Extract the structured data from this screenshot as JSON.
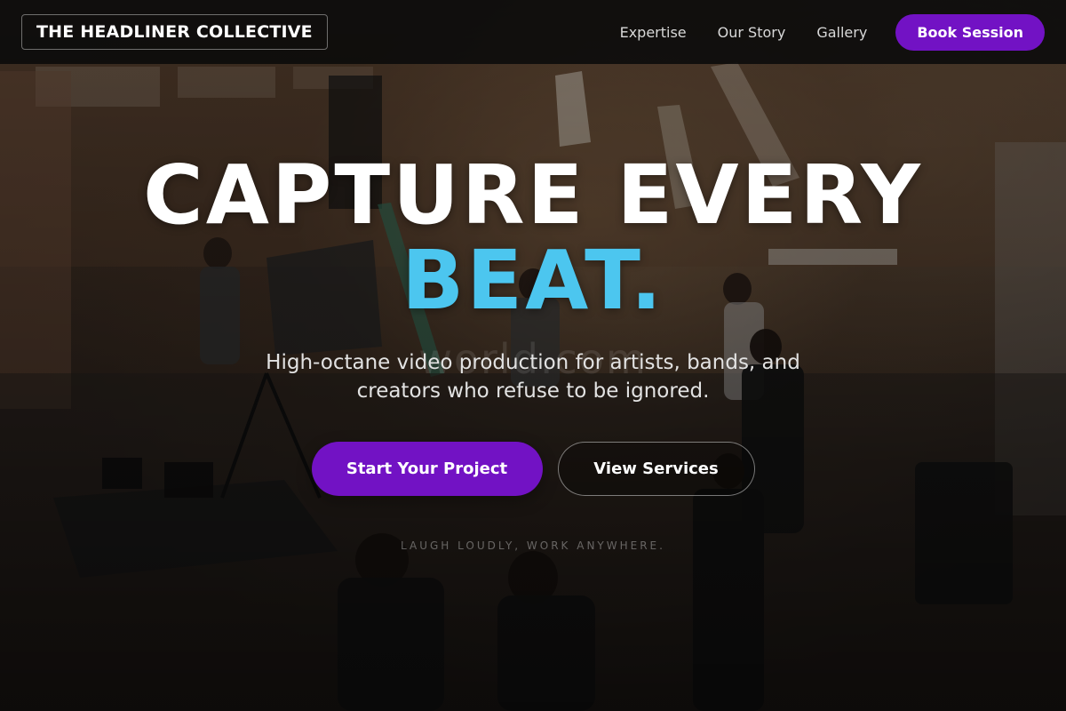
{
  "header": {
    "logo_text": "THE HEADLINER COLLECTIVE",
    "nav": [
      {
        "label": "Expertise"
      },
      {
        "label": "Our Story"
      },
      {
        "label": "Gallery"
      }
    ],
    "cta_label": "Book Session"
  },
  "hero": {
    "headline_line1": "CAPTURE EVERY",
    "headline_line2": "BEAT.",
    "watermark": "world.com",
    "subtitle": "High-octane video production for artists, bands, and creators who refuse to be ignored.",
    "primary_cta": "Start Your Project",
    "secondary_cta": "View Services",
    "tagline": "LAUGH LOUDLY, WORK ANYWHERE."
  },
  "colors": {
    "accent_purple": "#7212c4",
    "accent_cyan": "#4cc6ef",
    "header_bg": "#0a0a0a"
  },
  "background": {
    "description_icon": "film-set-photo"
  }
}
